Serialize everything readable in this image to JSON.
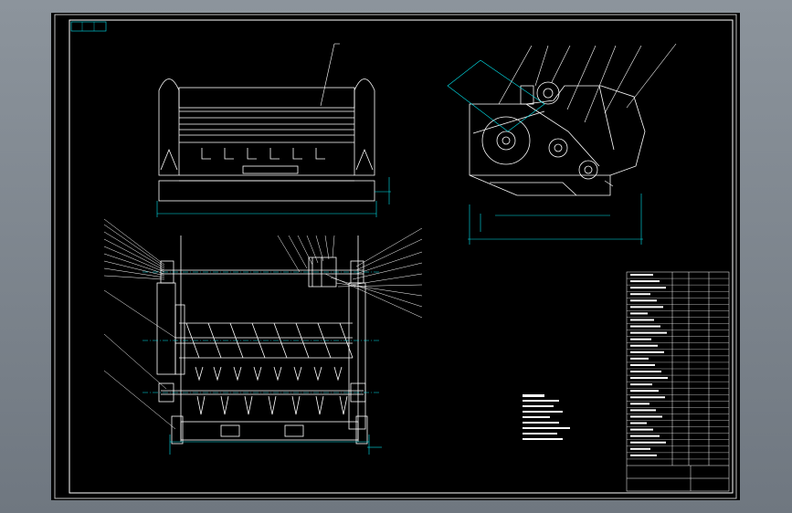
{
  "window": {
    "background_gradient": [
      "#8c949c",
      "#6f7780"
    ],
    "canvas_color": "#000000"
  },
  "colors": {
    "outline": "#ffffff",
    "dimension": "#00e5ee",
    "leader": "#ffffff",
    "hatch": "#ffffff"
  },
  "title_stamp": {
    "corner_label": "",
    "stamp_text": "",
    "drawing_no": ""
  },
  "views": {
    "front": {
      "name": "front-view"
    },
    "side": {
      "name": "side-view"
    },
    "section": {
      "name": "section-view",
      "section_label": ""
    }
  },
  "parts_list": {
    "rows": 30,
    "columns": 4
  },
  "technical_notes": {
    "lines": 9
  }
}
